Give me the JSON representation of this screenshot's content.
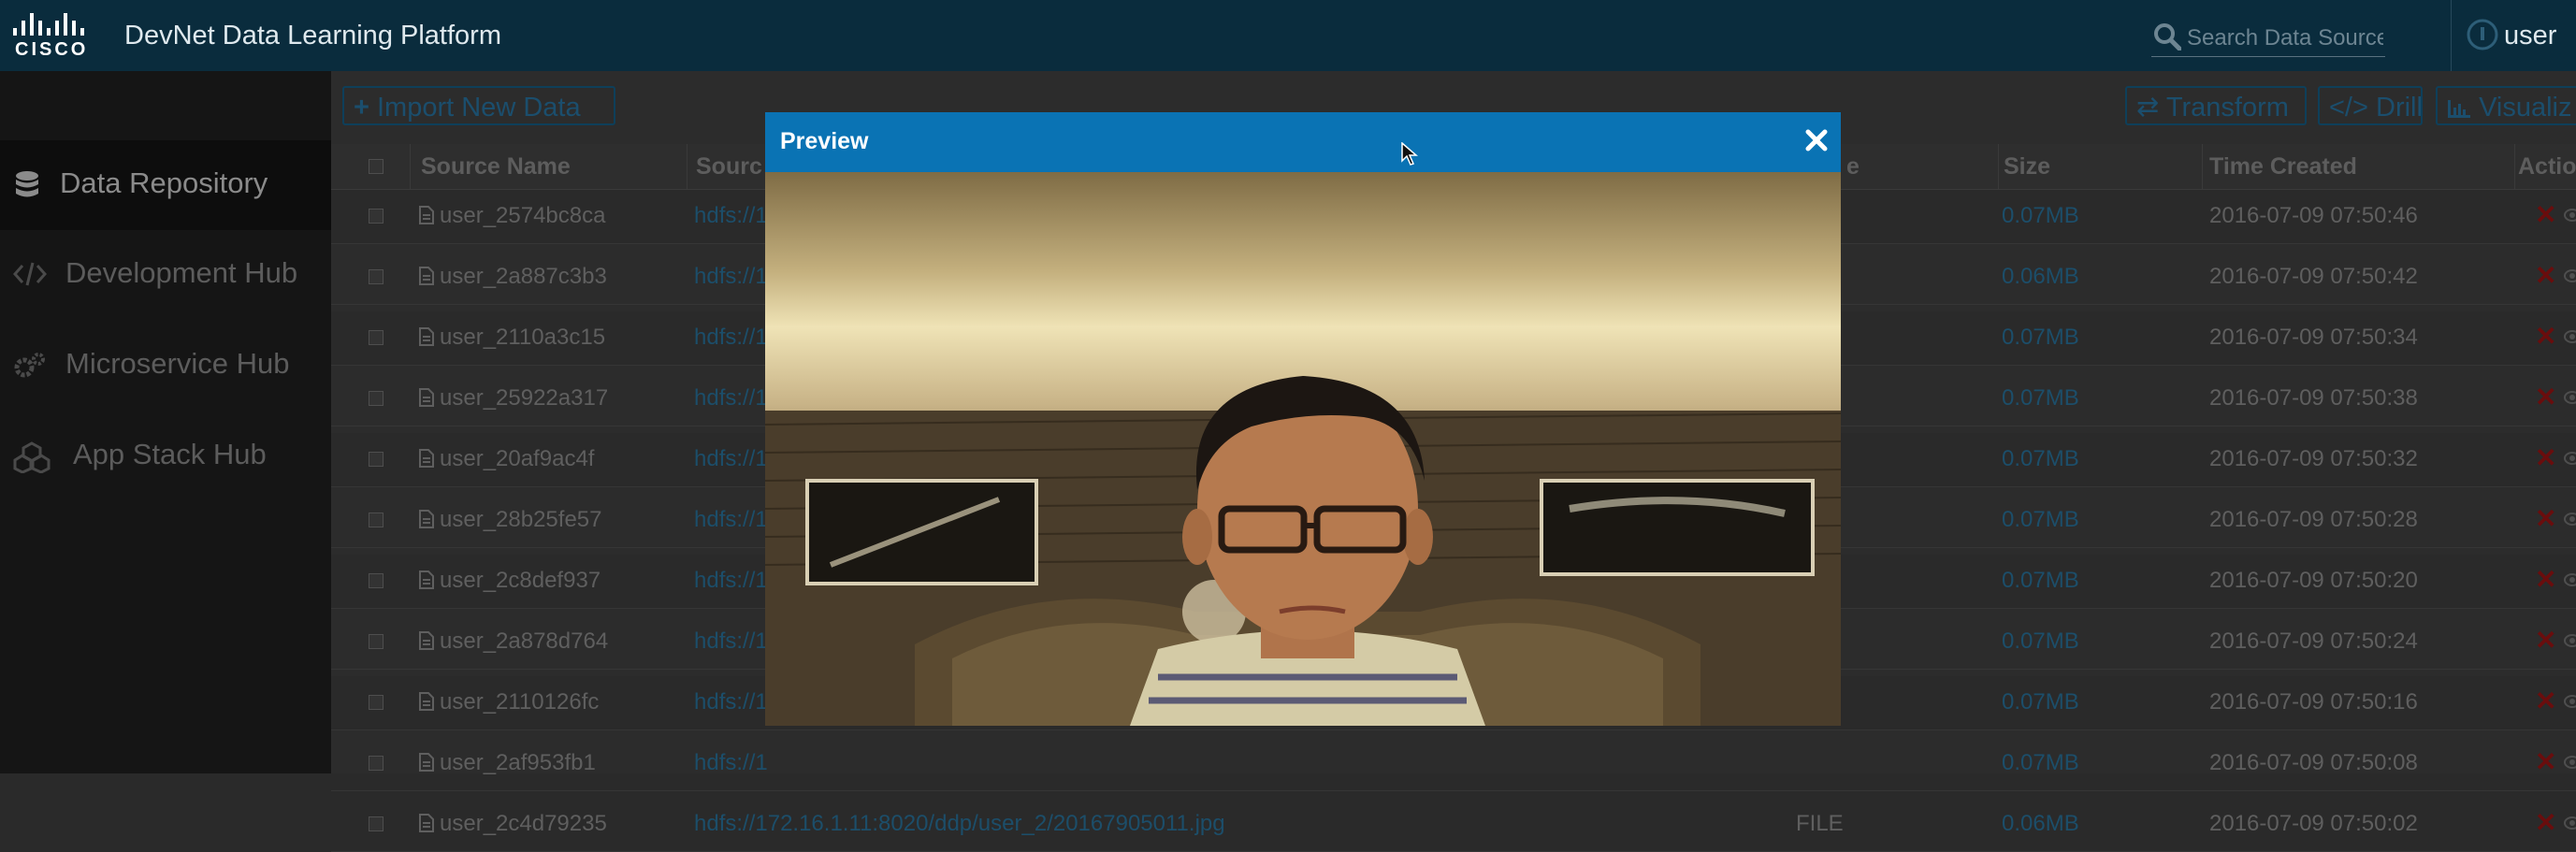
{
  "header": {
    "logo_text": "CISCO",
    "app_title": "DevNet Data Learning Platform",
    "search": {
      "placeholder": "Search Data Source"
    },
    "user_label": "user",
    "colors": {
      "bar": "#0a2c3d",
      "accent": "#0a73b4"
    }
  },
  "sidebar": {
    "items": [
      {
        "label": "Data Repository",
        "icon": "database-icon",
        "active": true
      },
      {
        "label": "Development Hub",
        "icon": "code-icon",
        "active": false
      },
      {
        "label": "Microservice Hub",
        "icon": "gears-icon",
        "active": false
      },
      {
        "label": "App Stack Hub",
        "icon": "cubes-icon",
        "active": false
      }
    ]
  },
  "toolbar": {
    "import_label": "Import New Data",
    "transform_label": "Transform",
    "drill_label": "Drill",
    "visualize_label": "Visualiz"
  },
  "table": {
    "columns": {
      "source_name": "Source Name",
      "source": "Sourc",
      "type": "e",
      "size": "Size",
      "time_created": "Time Created",
      "action": "Actio"
    },
    "rows": [
      {
        "name": "user_2574bc8ca",
        "link": "hdfs://1",
        "type": "",
        "size": "0.07MB",
        "time": "2016-07-09 07:50:46"
      },
      {
        "name": "user_2a887c3b3",
        "link": "hdfs://1",
        "type": "",
        "size": "0.06MB",
        "time": "2016-07-09 07:50:42"
      },
      {
        "name": "user_2110a3c15",
        "link": "hdfs://1",
        "type": "",
        "size": "0.07MB",
        "time": "2016-07-09 07:50:34"
      },
      {
        "name": "user_25922a317",
        "link": "hdfs://1",
        "type": "",
        "size": "0.07MB",
        "time": "2016-07-09 07:50:38"
      },
      {
        "name": "user_20af9ac4f",
        "link": "hdfs://1",
        "type": "",
        "size": "0.07MB",
        "time": "2016-07-09 07:50:32"
      },
      {
        "name": "user_28b25fe57",
        "link": "hdfs://1",
        "type": "",
        "size": "0.07MB",
        "time": "2016-07-09 07:50:28"
      },
      {
        "name": "user_2c8def937",
        "link": "hdfs://1",
        "type": "",
        "size": "0.07MB",
        "time": "2016-07-09 07:50:20"
      },
      {
        "name": "user_2a878d764",
        "link": "hdfs://1",
        "type": "",
        "size": "0.07MB",
        "time": "2016-07-09 07:50:24"
      },
      {
        "name": "user_2110126fc",
        "link": "hdfs://1",
        "type": "",
        "size": "0.07MB",
        "time": "2016-07-09 07:50:16"
      },
      {
        "name": "user_2af953fb1",
        "link": "hdfs://1",
        "type": "",
        "size": "0.07MB",
        "time": "2016-07-09 07:50:08"
      },
      {
        "name": "user_2c4d79235",
        "link": "hdfs://172.16.1.11:8020/ddp/user_2/20167905011.jpg",
        "type": "FILE",
        "size": "0.06MB",
        "time": "2016-07-09 07:50:02"
      }
    ]
  },
  "modal": {
    "title": "Preview",
    "close_icon": "close-icon",
    "content": "photo-preview"
  }
}
